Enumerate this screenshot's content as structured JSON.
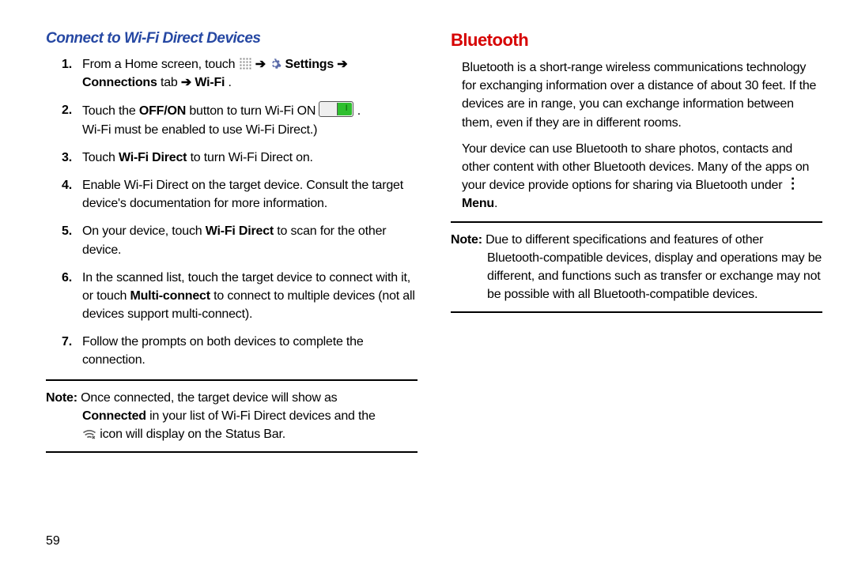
{
  "pageNumber": "59",
  "left": {
    "heading": "Connect to Wi-Fi Direct Devices",
    "steps": [
      {
        "num": "1.",
        "pre": "From a Home screen, touch ",
        "icon1": "apps-icon",
        "mid1": " ",
        "arrow1": "➔",
        "mid1b": " ",
        "icon2": "gear-icon",
        "mid2": " ",
        "bold2": "Settings",
        "mid3": " ",
        "arrow2": "➔",
        "line2bold": "Connections",
        "line2a": " tab ",
        "arrow3": "➔",
        "line2b": " ",
        "bold3": "Wi-Fi",
        "line2end": "."
      },
      {
        "num": "2.",
        "pre": "Touch the ",
        "bold1": "OFF/ON",
        "mid1": " button to turn Wi-Fi ON ",
        "icon1": "toggle-on-icon",
        "after": ".",
        "line2": "Wi-Fi must be enabled to use Wi-Fi Direct.)"
      },
      {
        "num": "3.",
        "pre": "Touch ",
        "bold1": "Wi-Fi Direct",
        "after": " to turn Wi-Fi Direct on."
      },
      {
        "num": "4.",
        "text": "Enable Wi-Fi Direct on the target device. Consult the target device's documentation for more information."
      },
      {
        "num": "5.",
        "pre": "On your device, touch ",
        "bold1": "Wi-Fi Direct",
        "after": " to scan for the other device."
      },
      {
        "num": "6.",
        "pre": "In the scanned list, touch the target device to connect with it, or touch ",
        "bold1": "Multi-connect",
        "after": " to connect to multiple devices (not all devices support multi-connect)."
      },
      {
        "num": "7.",
        "text": "Follow the prompts on both devices to complete the connection."
      }
    ],
    "note": {
      "lead": "Note:",
      "line1": " Once connected, the target device will show as",
      "line2bold": "Connected",
      "line2": " in your list of Wi-Fi Direct devices and the",
      "line3after": " icon will display on the Status Bar."
    }
  },
  "right": {
    "heading": "Bluetooth",
    "para1": "Bluetooth is a short-range wireless communications technology for exchanging information over a distance of about 30 feet. If the devices are in range, you can exchange information between them, even if they are in different rooms.",
    "para2pre": "Your device can use Bluetooth to share photos, contacts and other content with other Bluetooth devices. Many of the apps on your device provide options for sharing via Bluetooth under ",
    "para2bold": "Menu",
    "para2end": ".",
    "note": {
      "lead": "Note:",
      "body": " Due to different specifications and features of other Bluetooth-compatible devices, display and operations may be different, and functions such as transfer or exchange may not be possible with all Bluetooth-compatible devices."
    }
  }
}
